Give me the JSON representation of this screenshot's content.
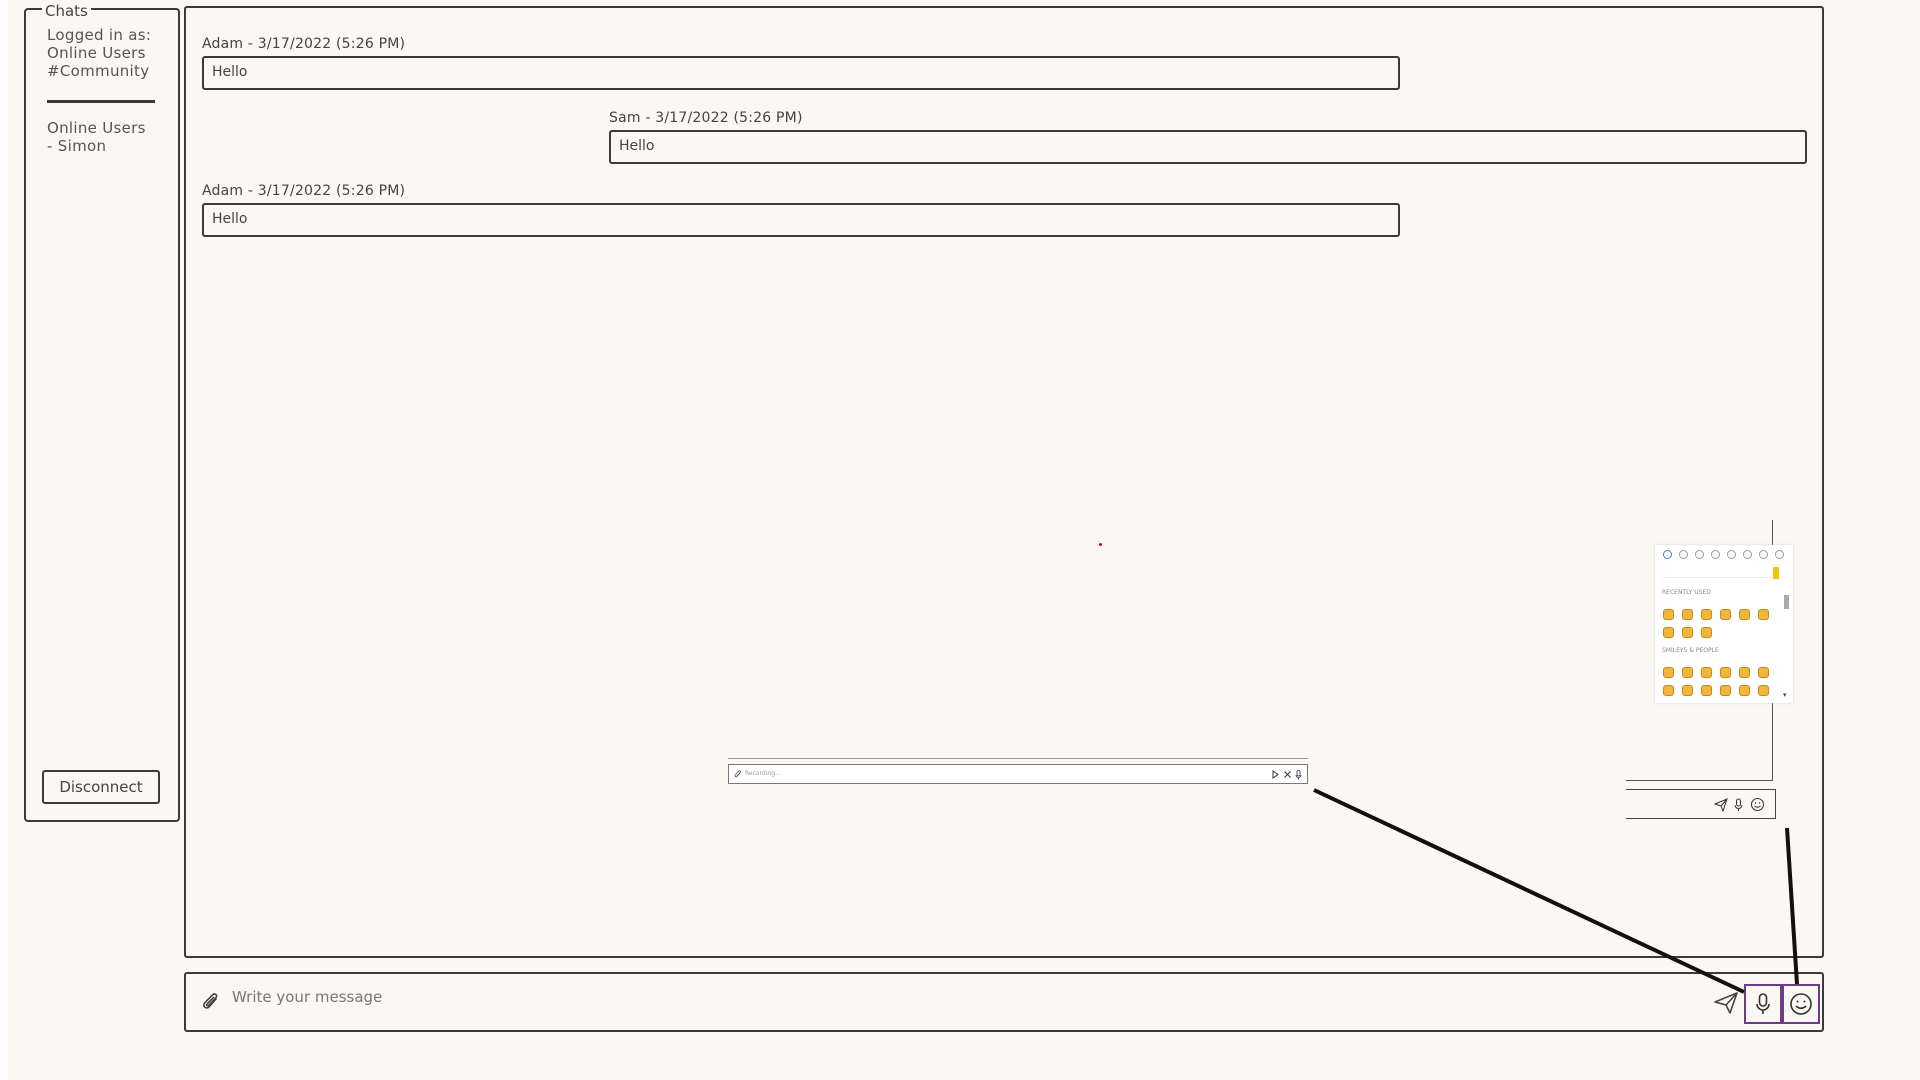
{
  "sidebar": {
    "title": "Chats",
    "logged_in_label": "Logged in as:",
    "logged_in_line2": "Online Users",
    "channel": "#Community",
    "online_users_heading": "Online Users",
    "online_users": [
      "- Simon"
    ],
    "disconnect_label": "Disconnect"
  },
  "messages": [
    {
      "meta": "Adam - 3/17/2022 (5:26 PM)",
      "text": "Hello",
      "side": "left"
    },
    {
      "meta": "Sam - 3/17/2022 (5:26 PM)",
      "text": "Hello",
      "side": "right"
    },
    {
      "meta": "Adam - 3/17/2022 (5:26 PM)",
      "text": "Hello",
      "side": "left"
    }
  ],
  "emoji_picker": {
    "recently_used_label": "RECENTLY USED",
    "smileys_label": "SMILEYS & PEOPLE"
  },
  "recording": {
    "text": "Recording..."
  },
  "composer": {
    "placeholder": "Write your message",
    "value": ""
  },
  "icons": {
    "attach": "paperclip-icon",
    "send": "send-icon",
    "mic": "microphone-icon",
    "emoji": "smiley-icon"
  },
  "colors": {
    "background": "#fbf7f2",
    "stroke": "#3a3a3a",
    "highlight": "#6a3c8a",
    "emoji_accent": "#f5c400"
  }
}
